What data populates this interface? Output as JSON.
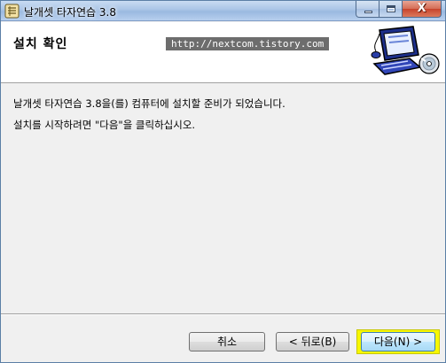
{
  "window": {
    "title": "날개셋 타자연습 3.8",
    "icon": "keyboard-app-icon",
    "caption_buttons": {
      "minimize": "minimize-icon",
      "maximize": "maximize-icon",
      "close": "X"
    }
  },
  "banner": {
    "title": "설치 확인",
    "url": "http://nextcom.tistory.com",
    "art_icon": "computer-with-cd-icon"
  },
  "body": {
    "line1": "날개셋 타자연습 3.8을(를) 컴퓨터에 설치할 준비가 되었습니다.",
    "line2": "설치를 시작하려면 \"다음\"을 클릭하십시오."
  },
  "buttons": {
    "cancel": "취소",
    "back": "< 뒤로(B)",
    "next": "다음(N) >"
  },
  "colors": {
    "highlight": "#f7f700",
    "window_frame": "#5b7fa6",
    "close_button": "#c7432c"
  }
}
